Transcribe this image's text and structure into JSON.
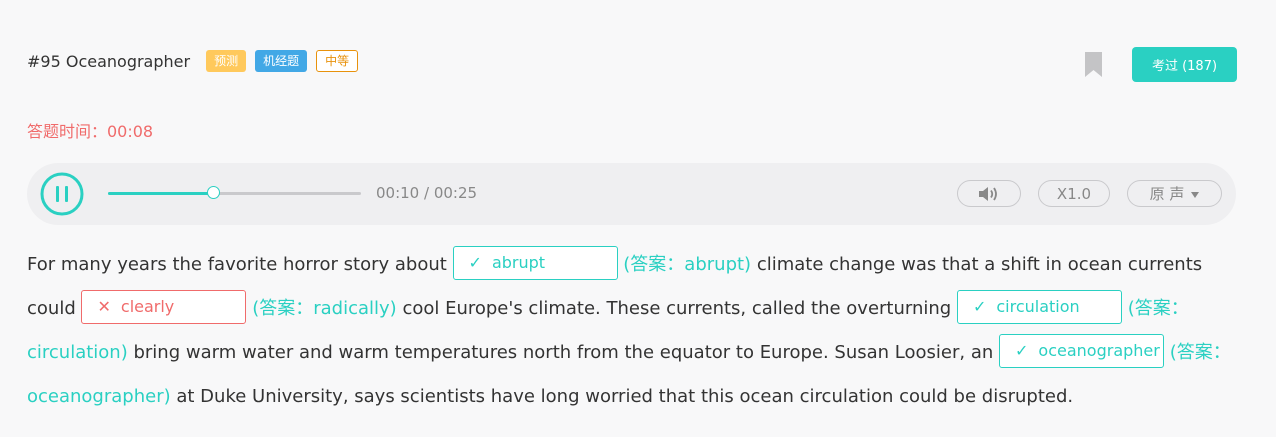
{
  "header": {
    "title": "#95 Oceanographer",
    "tags": [
      "预测",
      "机经题",
      "中等"
    ]
  },
  "actions": {
    "passed_label": "考过 (187)"
  },
  "timer": {
    "label": "答题时间：00:08"
  },
  "player": {
    "time_readout": "00:10 / 00:25",
    "progress_fraction": 0.42,
    "speed_label": "X1.0",
    "source_label": "原 声"
  },
  "passage": {
    "seg1": "For many years the favorite horror story about",
    "blank1": {
      "value": "abrupt",
      "answer": "(答案：abrupt)",
      "status": "correct"
    },
    "seg2": "climate change was that a shift in ocean currents could",
    "blank2": {
      "value": "clearly",
      "answer": "(答案：radically)",
      "status": "wrong"
    },
    "seg3": "cool Europe's climate. These currents, called the overturning",
    "blank3": {
      "value": "circulation",
      "answer": "(答案：circulation)",
      "status": "correct"
    },
    "seg4": "bring warm water and warm temperatures north from the equator to Europe. Susan Loosier, an",
    "blank4": {
      "value": "oceanographer",
      "answer": "(答案：oceanographer)",
      "status": "correct"
    },
    "seg5": "at Duke University, says scientists have long worried that this ocean circulation could be disrupted."
  },
  "marks": {
    "correct": "✓",
    "wrong": "✕"
  },
  "colors": {
    "accent": "#2ad0c2",
    "error": "#f06b6b",
    "tag_predict": "#ffc95c",
    "tag_machine": "#42a8e6",
    "tag_level": "#e8920c"
  },
  "icons": [
    "bookmark-icon",
    "pause-icon",
    "volume-icon",
    "caret-down-icon",
    "check-icon",
    "cross-icon"
  ]
}
